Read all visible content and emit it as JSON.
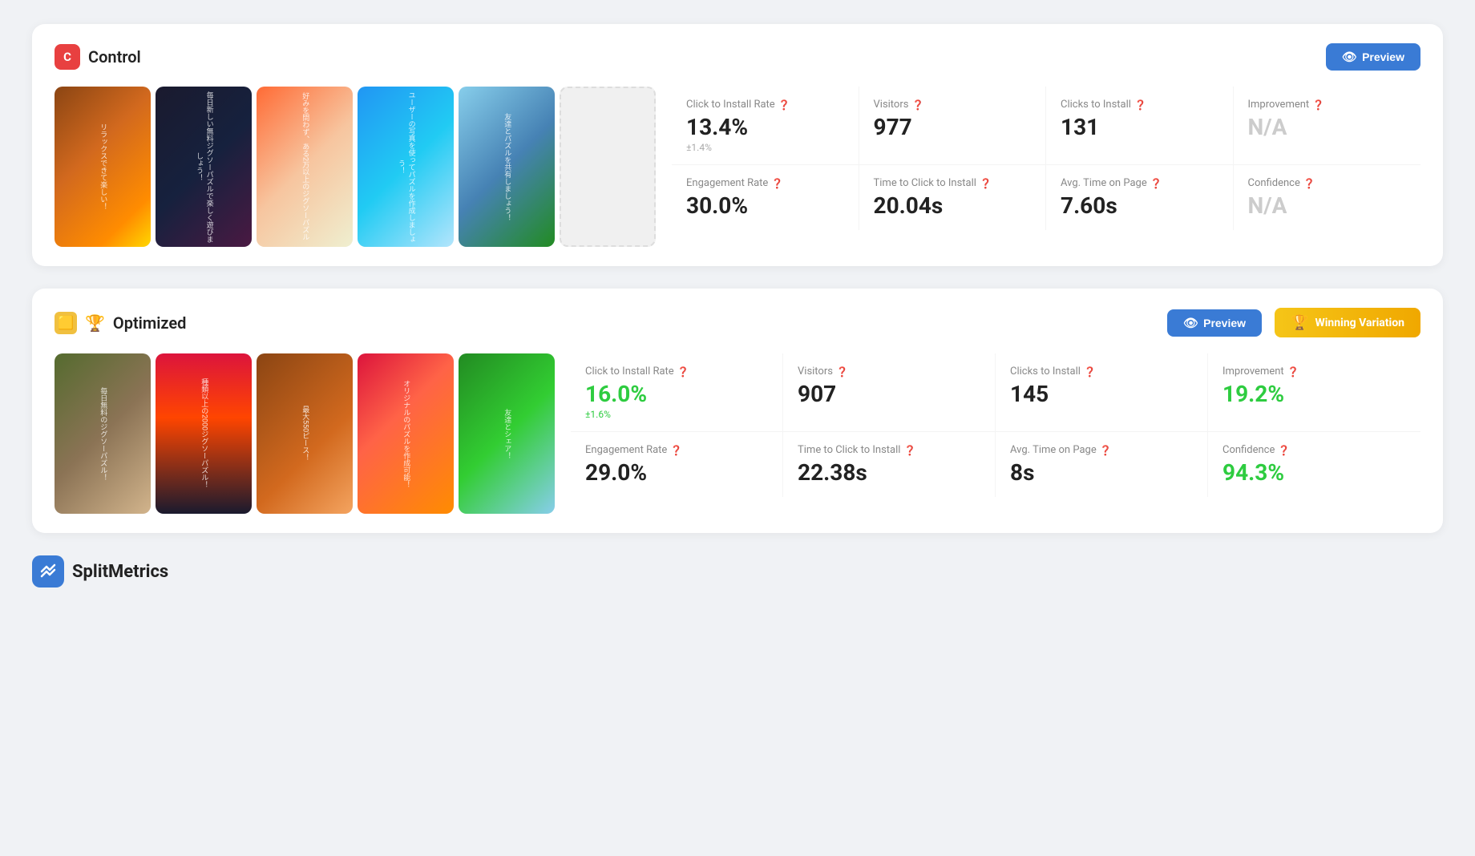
{
  "control": {
    "badge_letter": "C",
    "title": "Control",
    "preview_label": "Preview",
    "stats": {
      "row1": [
        {
          "label": "Click to Install Rate",
          "help": true,
          "value": "13.4%",
          "sub": "±1.4%",
          "value_color": "normal"
        },
        {
          "label": "Visitors",
          "help": true,
          "value": "977",
          "sub": "",
          "value_color": "normal"
        },
        {
          "label": "Clicks to Install",
          "help": true,
          "value": "131",
          "sub": "",
          "value_color": "normal"
        },
        {
          "label": "Improvement",
          "help": true,
          "value": "N/A",
          "sub": "",
          "value_color": "gray"
        }
      ],
      "row2": [
        {
          "label": "Engagement Rate",
          "help": true,
          "value": "30.0%",
          "sub": "",
          "value_color": "normal"
        },
        {
          "label": "Time to Click to Install",
          "help": true,
          "value": "20.04s",
          "sub": "",
          "value_color": "normal"
        },
        {
          "label": "Avg. Time on Page",
          "help": true,
          "value": "7.60s",
          "sub": "",
          "value_color": "normal"
        },
        {
          "label": "Confidence",
          "help": true,
          "value": "N/A",
          "sub": "",
          "value_color": "gray"
        }
      ]
    },
    "screenshots": [
      {
        "bg": "ss-1-ctrl",
        "text": "リラックスできて楽しい！"
      },
      {
        "bg": "ss-2-ctrl",
        "text": "毎日新しい無料ジグソーパズルで楽しく遊びましょう！"
      },
      {
        "bg": "ss-3-ctrl",
        "text": "好みを問わず、ある2万以上のジグソーパズル"
      },
      {
        "bg": "ss-4-ctrl",
        "text": "ユーザーの写真を使ってパズルを作成しましょう！"
      },
      {
        "bg": "ss-5-ctrl",
        "text": "友達とパズルを共有しましょう！"
      }
    ]
  },
  "optimized": {
    "badge_color": "#f0c040",
    "title": "Optimized",
    "preview_label": "Preview",
    "winning_label": "Winning Variation",
    "stats": {
      "row1": [
        {
          "label": "Click to Install Rate",
          "help": true,
          "value": "16.0%",
          "sub": "±1.6%",
          "value_color": "green"
        },
        {
          "label": "Visitors",
          "help": true,
          "value": "907",
          "sub": "",
          "value_color": "normal"
        },
        {
          "label": "Clicks to Install",
          "help": true,
          "value": "145",
          "sub": "",
          "value_color": "normal"
        },
        {
          "label": "Improvement",
          "help": true,
          "value": "19.2%",
          "sub": "",
          "value_color": "green"
        }
      ],
      "row2": [
        {
          "label": "Engagement Rate",
          "help": true,
          "value": "29.0%",
          "sub": "",
          "value_color": "normal"
        },
        {
          "label": "Time to Click to Install",
          "help": true,
          "value": "22.38s",
          "sub": "",
          "value_color": "normal"
        },
        {
          "label": "Avg. Time on Page",
          "help": true,
          "value": "8s",
          "sub": "",
          "value_color": "normal"
        },
        {
          "label": "Confidence",
          "help": true,
          "value": "94.3%",
          "sub": "",
          "value_color": "green"
        }
      ]
    },
    "screenshots": [
      {
        "bg": "ss-1-opt",
        "text": "毎日無料のジグソーパズル！"
      },
      {
        "bg": "ss-2-opt",
        "text": "種類以上の2000ジグソーパズル！"
      },
      {
        "bg": "ss-3-opt",
        "text": "最大550ピース！"
      },
      {
        "bg": "ss-4-opt",
        "text": "オリジナルのパズルを作成可能！"
      },
      {
        "bg": "ss-5-opt",
        "text": "友達とシェア！"
      }
    ]
  },
  "logo": {
    "icon": "✏",
    "text": "SplitMetrics"
  }
}
